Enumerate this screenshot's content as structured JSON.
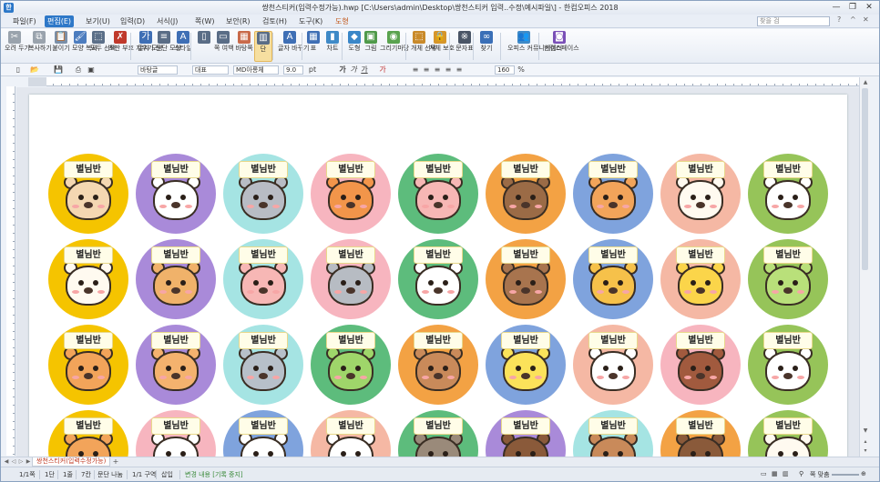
{
  "window": {
    "app_icon_glyph": "한",
    "title": "쌍천스티커(입력수정가능).hwp [C:\\Users\\admin\\Desktop\\쌍천스티커 입력..수정\\예시파일\\] - 한컴오피스 2018",
    "buttons": {
      "minimize": "—",
      "restore": "❐",
      "close": "✕"
    }
  },
  "menubar": {
    "items": [
      "파일(F)",
      "편집(E)",
      "보기(U)",
      "입력(D)",
      "서식(J)",
      "쪽(W)",
      "보안(R)",
      "검토(H)",
      "도구(K)",
      "도형"
    ],
    "active_index": 1,
    "search_placeholder": "찾을 검",
    "right_icons": [
      "?",
      "^",
      "✕"
    ]
  },
  "ribbon": {
    "buttons": [
      {
        "label": "오려 두기",
        "icon": "scissors-icon",
        "glyph": "✂",
        "color": "#9aa3ad"
      },
      {
        "label": "복사하기",
        "icon": "copy-icon",
        "glyph": "⧉",
        "color": "#9aa3ad"
      },
      {
        "label": "붙이기",
        "icon": "paste-icon",
        "glyph": "📋",
        "color": "#7a8fa8"
      },
      {
        "label": "모양 복사",
        "icon": "format-painter-icon",
        "glyph": "🖌",
        "color": "#4d7dbf"
      },
      {
        "label": "모두 선택",
        "icon": "select-all-icon",
        "glyph": "⬚",
        "color": "#5b6f88"
      },
      {
        "label": "조판 부호 지우기",
        "icon": "clear-marks-icon",
        "glyph": "✗",
        "color": "#c0392b"
      },
      {
        "label": "글자 모양",
        "icon": "char-shape-icon",
        "glyph": "가",
        "color": "#3f6fb5"
      },
      {
        "label": "문단 모양",
        "icon": "para-shape-icon",
        "glyph": "≡",
        "color": "#5a6d86"
      },
      {
        "label": "스타일",
        "icon": "style-icon",
        "glyph": "A",
        "color": "#3f6fb5"
      },
      {
        "label": "",
        "icon": "page-icon",
        "glyph": "▯",
        "color": "#5a6d86"
      },
      {
        "label": "쪽 여백",
        "icon": "margin-icon",
        "glyph": "▭",
        "color": "#5a6d86"
      },
      {
        "label": "바탕쪽",
        "icon": "master-page-icon",
        "glyph": "▦",
        "color": "#c96a4a"
      },
      {
        "label": "단",
        "icon": "columns-icon",
        "glyph": "▥",
        "color": "#5a6d86"
      },
      {
        "label": "글자 바꾸기",
        "icon": "replace-char-icon",
        "glyph": "A",
        "color": "#3f6fb5"
      },
      {
        "label": "표",
        "icon": "table-icon",
        "glyph": "▦",
        "color": "#3f6fb5"
      },
      {
        "label": "차트",
        "icon": "chart-icon",
        "glyph": "▮",
        "color": "#3f8ac7"
      },
      {
        "label": "도형",
        "icon": "shape-icon",
        "glyph": "◆",
        "color": "#3a87c8"
      },
      {
        "label": "그림",
        "icon": "picture-icon",
        "glyph": "▣",
        "color": "#4f9a4a"
      },
      {
        "label": "그리기마당",
        "icon": "drawing-icon",
        "glyph": "◉",
        "color": "#5aa34f"
      },
      {
        "label": "개체 선택",
        "icon": "select-object-icon",
        "glyph": "⬚",
        "color": "#c98a2a"
      },
      {
        "label": "개체 보호",
        "icon": "protect-object-icon",
        "glyph": "🔒",
        "color": "#d6962a"
      },
      {
        "label": "문자표",
        "icon": "symbol-icon",
        "glyph": "※",
        "color": "#4a5566"
      },
      {
        "label": "찾기",
        "icon": "find-icon",
        "glyph": "∞",
        "color": "#3a6fb7"
      },
      {
        "label": "오피스 커뮤니케이터",
        "icon": "communicator-icon",
        "glyph": "👥",
        "color": "#3f8ac7"
      },
      {
        "label": "한컴스페이스",
        "icon": "hancom-space-icon",
        "glyph": "◙",
        "color": "#7a4fb7"
      }
    ],
    "selected_index": 12
  },
  "format_bar": {
    "style": "바탕글",
    "language": "대표",
    "font": "MD아롱체",
    "size": "9.0",
    "unit": "pt",
    "line_spacing": "160",
    "line_spacing_unit": "%",
    "icons": [
      "new-icon",
      "open-icon",
      "save-icon",
      "print-icon",
      "preview-icon"
    ]
  },
  "stickers": {
    "label": "별님반",
    "colors": [
      "#f5c400",
      "#a98ad9",
      "#a5e4e3",
      "#f7b5bf",
      "#5dbc7c",
      "#f3a244",
      "#7fa3dd",
      "#f5b8a4",
      "#96c459"
    ],
    "rows": [
      {
        "colors": [
          0,
          1,
          2,
          3,
          4,
          5,
          6,
          7,
          8
        ],
        "animals": [
          "puppy",
          "cow",
          "mouse",
          "fox",
          "pig",
          "horse",
          "cat",
          "sheep",
          "rabbit"
        ],
        "face_colors": [
          "#f4d7b2",
          "#ffffff",
          "#b8bcc4",
          "#f2954a",
          "#f7b7b5",
          "#9b6b46",
          "#f2a45a",
          "#fffaf0",
          "#ffffff"
        ]
      },
      {
        "colors": [
          0,
          1,
          2,
          3,
          4,
          5,
          6,
          7,
          8
        ],
        "animals": [
          "sheep",
          "bear",
          "pig",
          "koala",
          "rabbit",
          "monkey",
          "tiger",
          "chicken",
          "turtle"
        ],
        "face_colors": [
          "#fffaf0",
          "#f0b26a",
          "#f7b7b5",
          "#b7bcc3",
          "#ffffff",
          "#a8744e",
          "#f6c14a",
          "#fbd54a",
          "#b9e07a"
        ]
      },
      {
        "colors": [
          0,
          1,
          2,
          4,
          5,
          6,
          7,
          3,
          8
        ],
        "animals": [
          "tiger",
          "cat",
          "elephant",
          "frog",
          "puppy",
          "chick",
          "polar-bear",
          "horse",
          "cow"
        ],
        "face_colors": [
          "#f2a45a",
          "#f4b26e",
          "#b7c0c9",
          "#9fd66a",
          "#c98a5a",
          "#fbe25a",
          "#ffffff",
          "#a15a3e",
          "#ffffff"
        ]
      },
      {
        "colors": [
          0,
          3,
          6,
          7,
          4,
          1,
          2,
          5,
          8
        ],
        "animals": [
          "tiger",
          "rabbit",
          "panda",
          "rabbit",
          "donkey",
          "bear",
          "bear",
          "bear",
          "sheep"
        ],
        "face_colors": [
          "#f2a45a",
          "#ffffff",
          "#ffffff",
          "#ffffff",
          "#9a8a7a",
          "#8a5a3a",
          "#c98a5a",
          "#8a5a3a",
          "#fffaf0"
        ]
      }
    ]
  },
  "tabs": {
    "document_tab": "쌍천스티커(입력수정가능)",
    "add_label": "+",
    "nav": [
      "◀",
      "◁",
      "▷",
      "▶"
    ]
  },
  "status": {
    "position": "1/1쪽",
    "section": "1단",
    "line": "1줄",
    "column": "7칸",
    "split": "문단 나눔",
    "zone": "1/1 구역",
    "mode": "삽입",
    "track": "변경 내용 [기록 중지]",
    "zoom": "쪽 맞춤"
  }
}
